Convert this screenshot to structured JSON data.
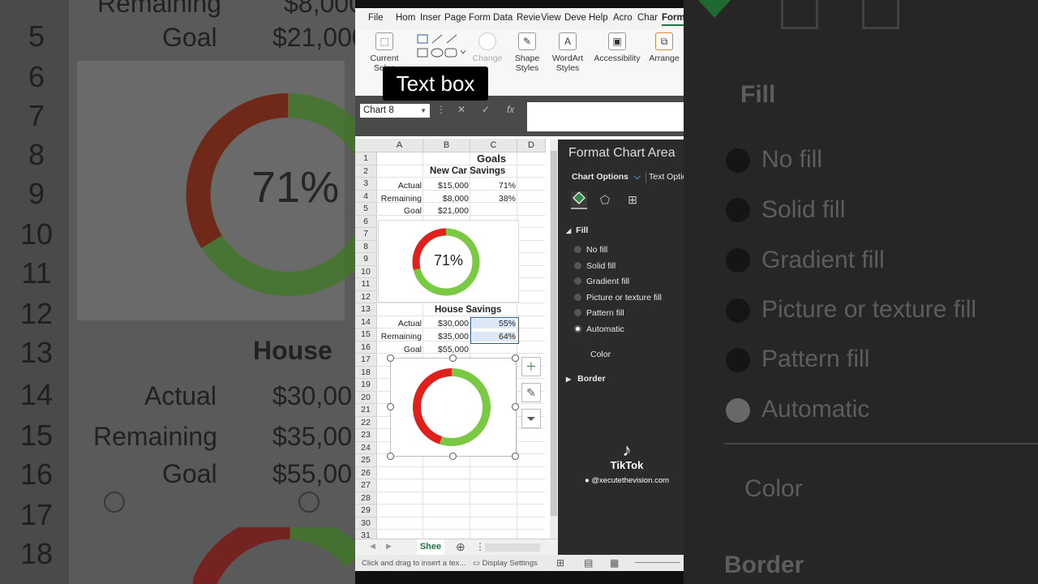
{
  "ribbon_tabs": [
    "File",
    "Hom",
    "Inser",
    "Page",
    "Form",
    "Data",
    "Revie",
    "View",
    "Deve",
    "Help",
    "Acro",
    "Char",
    "Form"
  ],
  "ribbon_buttons": {
    "current_selection": "Current Selec",
    "change_shape": "Change",
    "shape_styles": "Shape Styles",
    "wordart_styles": "WordArt Styles",
    "accessibility": "Accessibility",
    "arrange": "Arrange"
  },
  "tooltip": "Text box",
  "name_box": "Chart 8",
  "formula_icons": {
    "cancel": "✕",
    "enter": "✓",
    "fx": "fx"
  },
  "columns": [
    "A",
    "B",
    "C",
    "D"
  ],
  "rows": [
    "1",
    "2",
    "3",
    "4",
    "5",
    "6",
    "7",
    "8",
    "9",
    "10",
    "11",
    "12",
    "13",
    "14",
    "15",
    "16",
    "17",
    "18",
    "19",
    "20",
    "21",
    "22",
    "23",
    "24",
    "25",
    "26",
    "27",
    "28",
    "29",
    "30",
    "31"
  ],
  "sheet": {
    "goals_title": "Goals",
    "car": {
      "title": "New Car Savings",
      "rows": [
        {
          "label": "Actual",
          "amount": "$15,000",
          "pct": "71%"
        },
        {
          "label": "Remaining",
          "amount": "$8,000",
          "pct": "38%"
        },
        {
          "label": "Goal",
          "amount": "$21,000",
          "pct": ""
        }
      ]
    },
    "house": {
      "title": "House Savings",
      "rows": [
        {
          "label": "Actual",
          "amount": "$30,000",
          "pct": "55%"
        },
        {
          "label": "Remaining",
          "amount": "$35,000",
          "pct": "64%"
        },
        {
          "label": "Goal",
          "amount": "$55,000",
          "pct": ""
        }
      ]
    }
  },
  "charts": {
    "car_donut": {
      "label": "71%",
      "actual_fraction": 0.71,
      "colors": {
        "actual": "#7ac943",
        "remaining": "#e0201b"
      }
    },
    "house_donut": {
      "actual_fraction": 0.55,
      "colors": {
        "actual": "#7ac943",
        "remaining": "#e0201b"
      }
    }
  },
  "sheet_tab": "Shee",
  "status": {
    "hint": "Click and drag to insert a tex...",
    "display": "Display Settings"
  },
  "pane": {
    "title": "Format Chart Area",
    "tabs": {
      "chart_options": "Chart Options",
      "text_options": "Text Optio"
    },
    "fill_section": "Fill",
    "options": [
      "No fill",
      "Solid fill",
      "Gradient fill",
      "Picture or texture fill",
      "Pattern fill",
      "Automatic"
    ],
    "selected": "Automatic",
    "color_label": "Color",
    "border_section": "Border"
  },
  "watermark": {
    "brand": "TikTok",
    "handle": "@xecutethevision.com"
  },
  "backdrop": {
    "rows": [
      "5",
      "6",
      "7",
      "8",
      "9",
      "10",
      "11",
      "12",
      "13",
      "14",
      "15",
      "16",
      "17",
      "18"
    ],
    "left_texts": {
      "remaining": "Remaining",
      "goal": "Goal",
      "amount1": "$8,000",
      "amount2": "$21,000",
      "pct": "71%",
      "house": "House",
      "actual": "Actual",
      "house_amt1": "$30,00",
      "remaining2": "Remaining",
      "house_amt2": "$35,00",
      "goal2": "Goal",
      "house_amt3": "$55,00"
    },
    "right_texts": {
      "fill": "Fill",
      "o1": "No fill",
      "o2": "Solid fill",
      "o3": "Gradient fill",
      "o4": "Picture or texture fill",
      "o5": "Pattern fill",
      "o6": "Automatic",
      "color": "Color",
      "border": "Border"
    }
  }
}
